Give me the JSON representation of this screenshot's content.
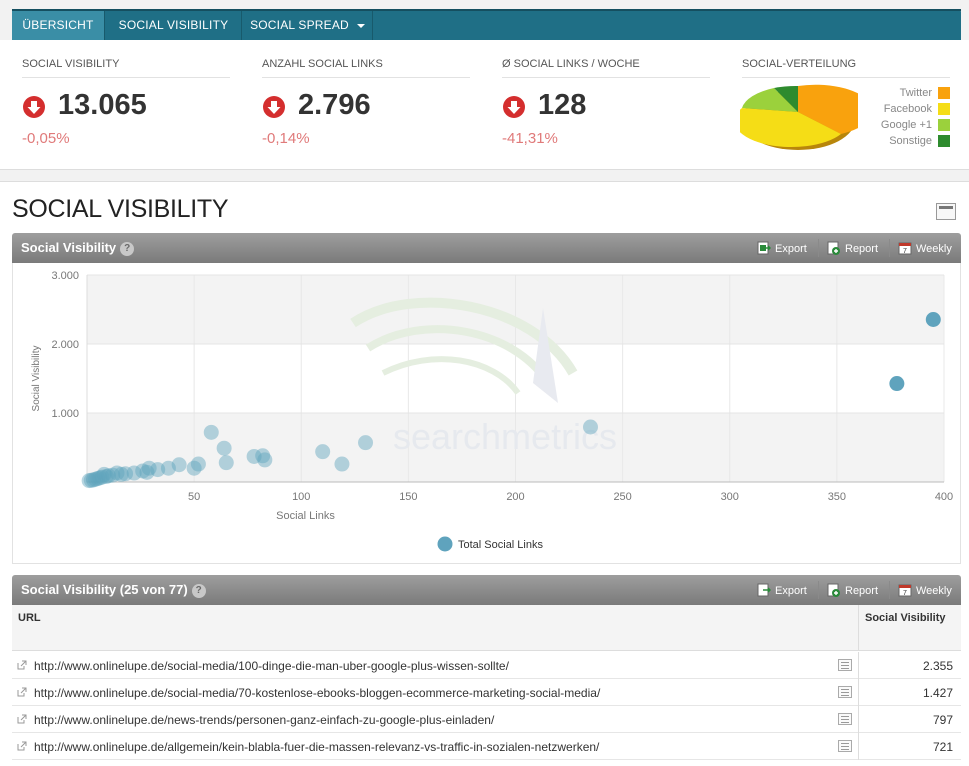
{
  "nav": {
    "tabs": [
      {
        "label": "ÜBERSICHT",
        "active": true
      },
      {
        "label": "SOCIAL VISIBILITY",
        "active": false
      },
      {
        "label": "SOCIAL SPREAD",
        "active": false,
        "dropdown": true
      }
    ]
  },
  "kpis": [
    {
      "label": "SOCIAL VISIBILITY",
      "value": "13.065",
      "delta": "-0,05%",
      "trend": "down"
    },
    {
      "label": "ANZAHL SOCIAL LINKS",
      "value": "2.796",
      "delta": "-0,14%",
      "trend": "down"
    },
    {
      "label": "Ø SOCIAL LINKS / WOCHE",
      "value": "128",
      "delta": "-41,31%",
      "trend": "down"
    }
  ],
  "distribution": {
    "label": "SOCIAL-VERTEILUNG",
    "legend": [
      {
        "name": "Twitter",
        "color": "#f9a20d"
      },
      {
        "name": "Facebook",
        "color": "#f5dd16"
      },
      {
        "name": "Google +1",
        "color": "#9bd13c"
      },
      {
        "name": "Sonstige",
        "color": "#2e8b2e"
      }
    ]
  },
  "section": {
    "title": "SOCIAL VISIBILITY"
  },
  "chart_panel": {
    "title": "Social Visibility",
    "help": "?",
    "actions": {
      "export": "Export",
      "report": "Report",
      "weekly": "Weekly"
    }
  },
  "chart_data": {
    "type": "scatter",
    "xlabel": "Social Links",
    "ylabel": "Social Visibility",
    "xlim": [
      0,
      400
    ],
    "ylim": [
      0,
      3000
    ],
    "x_ticks": [
      "50",
      "100",
      "150",
      "200",
      "250",
      "300",
      "350",
      "400"
    ],
    "y_ticks": [
      "1.000",
      "2.000",
      "3.000"
    ],
    "legend": "bottom",
    "watermark_text": "searchmetrics",
    "series": [
      {
        "name": "Total Social Links",
        "color": "#5fa3bd",
        "points": [
          [
            395,
            2355
          ],
          [
            378,
            1427
          ],
          [
            235,
            797
          ],
          [
            130,
            570
          ],
          [
            110,
            440
          ],
          [
            119,
            260
          ],
          [
            58,
            720
          ],
          [
            64,
            490
          ],
          [
            65,
            280
          ],
          [
            78,
            370
          ],
          [
            82,
            380
          ],
          [
            83,
            320
          ],
          [
            52,
            260
          ],
          [
            50,
            200
          ],
          [
            43,
            250
          ],
          [
            38,
            200
          ],
          [
            33,
            180
          ],
          [
            29,
            200
          ],
          [
            28,
            140
          ],
          [
            26,
            160
          ],
          [
            22,
            130
          ],
          [
            18,
            120
          ],
          [
            16,
            110
          ],
          [
            14,
            130
          ],
          [
            12,
            100
          ],
          [
            10,
            90
          ],
          [
            9,
            80
          ],
          [
            8,
            110
          ],
          [
            7,
            70
          ],
          [
            6,
            60
          ],
          [
            5,
            50
          ],
          [
            4,
            40
          ],
          [
            3,
            30
          ],
          [
            2,
            25
          ],
          [
            1,
            20
          ]
        ]
      }
    ]
  },
  "table_panel": {
    "title": "Social Visibility (25 von 77)",
    "help": "?",
    "actions": {
      "export": "Export",
      "report": "Report",
      "weekly": "Weekly"
    }
  },
  "table": {
    "headers": [
      "URL",
      "Social Visibility"
    ],
    "rows": [
      {
        "url": "http://www.onlinelupe.de/social-media/100-dinge-die-man-uber-google-plus-wissen-sollte/",
        "value": "2.355"
      },
      {
        "url": "http://www.onlinelupe.de/social-media/70-kostenlose-ebooks-bloggen-ecommerce-marketing-social-media/",
        "value": "1.427"
      },
      {
        "url": "http://www.onlinelupe.de/news-trends/personen-ganz-einfach-zu-google-plus-einladen/",
        "value": "797"
      },
      {
        "url": "http://www.onlinelupe.de/allgemein/kein-blabla-fuer-die-massen-relevanz-vs-traffic-in-sozialen-netzwerken/",
        "value": "721"
      }
    ]
  }
}
